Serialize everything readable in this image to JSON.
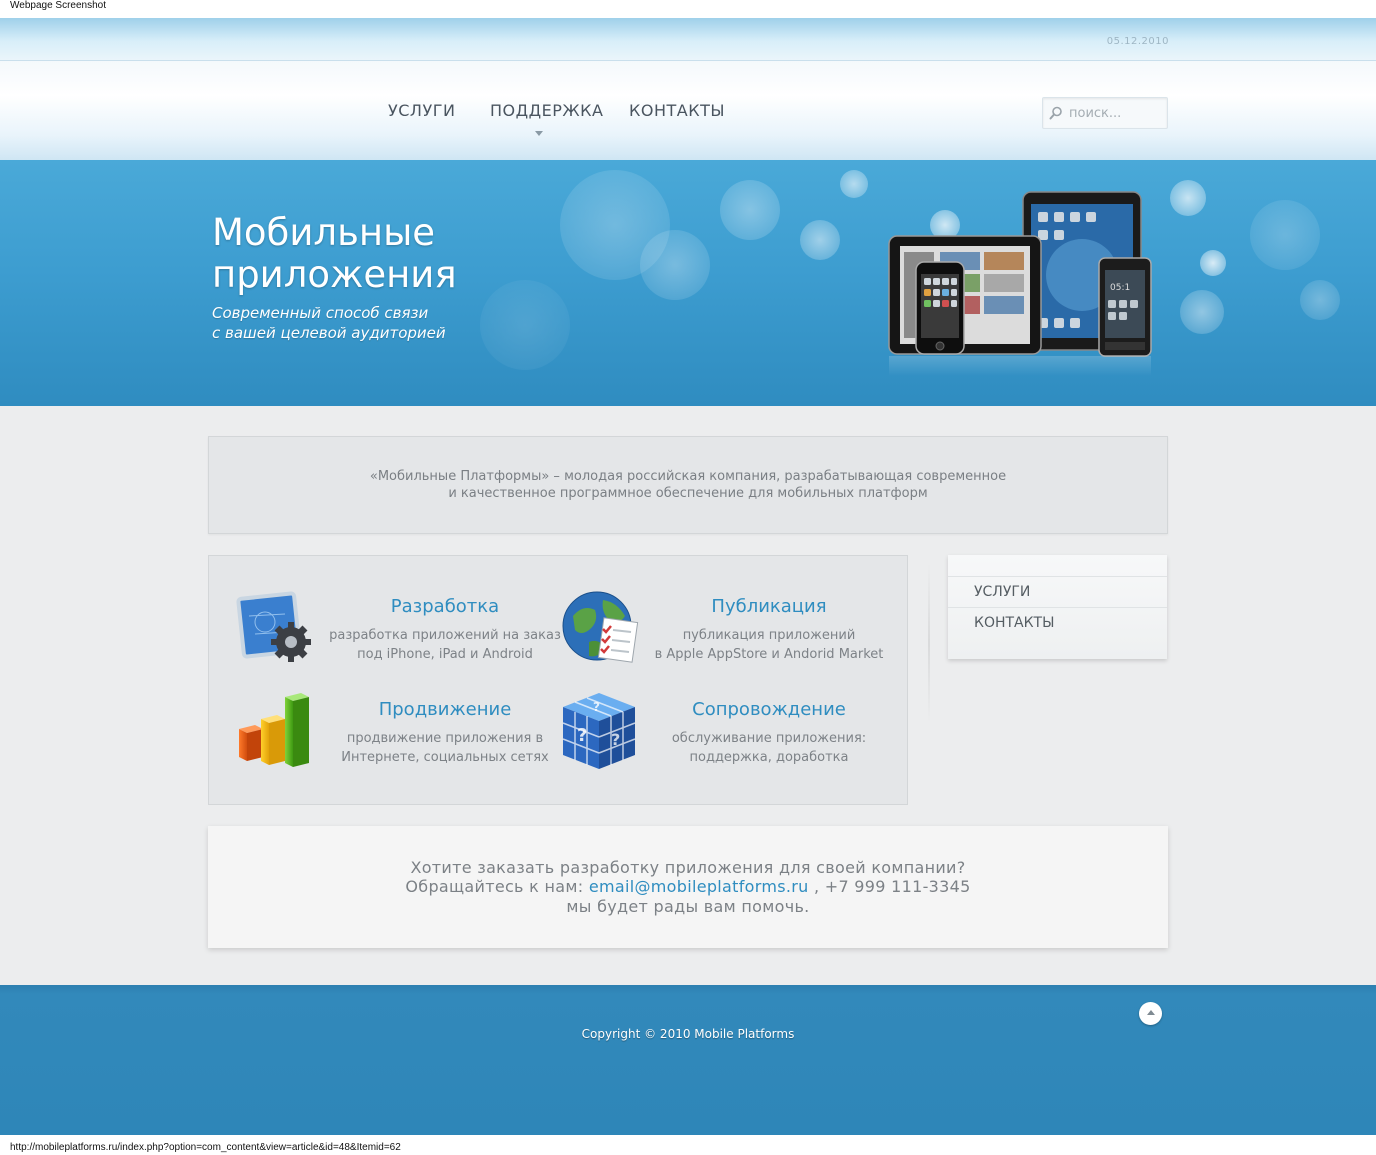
{
  "window": {
    "caption": "Webpage Screenshot",
    "status_url": "http://mobileplatforms.ru/index.php?option=com_content&view=article&id=48&Itemid=62"
  },
  "header": {
    "date": "05.12.2010",
    "nav": [
      {
        "label": "УСЛУГИ"
      },
      {
        "label": "ПОДДЕРЖКА"
      },
      {
        "label": "КОНТАКТЫ"
      }
    ],
    "search_placeholder": "поиск..."
  },
  "banner": {
    "title_line1": "Мобильные",
    "title_line2": "приложения",
    "subtitle_line1": "Современный способ связи",
    "subtitle_line2": "с вашей целевой аудиторией"
  },
  "intro": {
    "line1": "«Мобильные Платформы» – молодая российская компания, разрабатывающая современное",
    "line2": "и качественное программное обеспечение для мобильных платформ"
  },
  "services": [
    {
      "title": "Разработка",
      "desc1": "разработка приложений на заказ",
      "desc2": "под iPhone, iPad и Android",
      "icon": "blueprint-gear-icon"
    },
    {
      "title": "Публикация",
      "desc1": "публикация приложений",
      "desc2": "в Apple AppStore и Andorid Market",
      "icon": "globe-checklist-icon"
    },
    {
      "title": "Продвижение",
      "desc1": "продвижение приложения в",
      "desc2": "Интернете, социальных сетях",
      "icon": "bar-chart-icon"
    },
    {
      "title": "Сопровождение",
      "desc1": "обслуживание приложения:",
      "desc2": "поддержка, доработка",
      "icon": "help-cube-icon"
    }
  ],
  "sidebar": {
    "items": [
      {
        "label": "УСЛУГИ"
      },
      {
        "label": "КОНТАКТЫ"
      }
    ]
  },
  "cta": {
    "line1": "Хотите заказать разработку приложения для своей компании?",
    "line2_prefix": "Обращайтесь к нам:",
    "email": "email@mobileplatforms.ru",
    "line2_suffix": ", +7 999 111-3345",
    "line3": "мы будет рады вам помочь."
  },
  "footer": {
    "copyright": "Copyright © 2010 Mobile Platforms"
  },
  "colors": {
    "accent": "#2f8dc0",
    "banner": "#3d9dd0",
    "footer": "#2e86b8",
    "panel": "#e4e6e8"
  }
}
